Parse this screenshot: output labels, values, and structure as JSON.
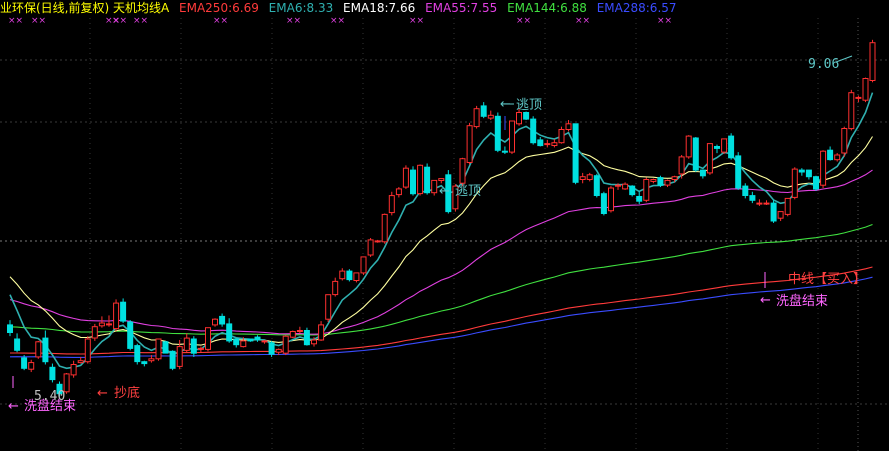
{
  "header": {
    "title": "业环保(日线,前复权) 天机均线A",
    "ema_items": [
      {
        "text": "EMA250:6.69",
        "color": "#ff3b3b"
      },
      {
        "text": "EMA6:8.33",
        "color": "#2fb0b0"
      },
      {
        "text": "EMA18:7.66",
        "color": "#ffffff"
      },
      {
        "text": "EMA55:7.55",
        "color": "#e040e0"
      },
      {
        "text": "EMA144:6.88",
        "color": "#40e040"
      },
      {
        "text": "EMA288:6.57",
        "color": "#3a4cff"
      }
    ]
  },
  "annotations": [
    {
      "key": "flee_top_1",
      "text": "逃顶"
    },
    {
      "key": "flee_top_2",
      "text": "逃顶"
    },
    {
      "key": "bottom_fish",
      "text": "抄底"
    },
    {
      "key": "wash_end_1",
      "text": "洗盘结束"
    },
    {
      "key": "wash_end_2",
      "text": "洗盘结束"
    },
    {
      "key": "midline",
      "text": "中线【买入】"
    }
  ],
  "price_labels": {
    "high": "9.06",
    "low": "5.40"
  },
  "chart_data": {
    "type": "candlestick",
    "ylim": [
      5.1,
      9.55
    ],
    "grid": true,
    "colors": {
      "up": "#ff3030",
      "down": "#00e0e0",
      "ema6": "#2fb0b0",
      "ema18": "#ffffa0",
      "ema55": "#e040e0",
      "ema144": "#40e040",
      "ema250": "#ff3b3b",
      "ema288": "#3a4cff"
    },
    "close": [
      6.24,
      6.05,
      5.86,
      5.92,
      6.14,
      5.93,
      5.74,
      5.59,
      5.8,
      5.9,
      5.94,
      6.17,
      6.3,
      6.34,
      6.33,
      6.55,
      6.36,
      6.07,
      5.93,
      5.91,
      5.96,
      6.17,
      6.02,
      5.86,
      6.09,
      6.18,
      6.02,
      6.07,
      6.29,
      6.38,
      6.33,
      6.15,
      6.11,
      6.15,
      6.15,
      6.16,
      6.15,
      6.01,
      6.06,
      6.2,
      6.25,
      6.26,
      6.11,
      6.16,
      6.32,
      6.64,
      6.78,
      6.89,
      6.8,
      6.87,
      7.04,
      7.22,
      7.21,
      7.49,
      7.69,
      7.76,
      7.98,
      7.71,
      8.01,
      7.72,
      7.85,
      7.87,
      7.52,
      7.79,
      8.08,
      8.43,
      8.61,
      8.53,
      8.54,
      8.17,
      8.15,
      8.48,
      8.57,
      8.5,
      8.25,
      8.22,
      8.24,
      8.25,
      8.39,
      8.45,
      7.83,
      7.89,
      7.91,
      7.69,
      7.5,
      7.77,
      7.8,
      7.81,
      7.7,
      7.63,
      7.86,
      7.86,
      7.8,
      7.85,
      7.89,
      8.1,
      8.32,
      7.96,
      7.9,
      8.24,
      8.19,
      8.29,
      8.09,
      7.77,
      7.69,
      7.64,
      7.61,
      7.61,
      7.42,
      7.52,
      7.66,
      7.97,
      7.94,
      7.89,
      7.76,
      8.16,
      8.07,
      8.12,
      8.4,
      8.78,
      8.73,
      8.93,
      9.31
    ],
    "open": [
      6.32,
      6.17,
      5.97,
      5.85,
      5.98,
      6.18,
      5.87,
      5.69,
      5.61,
      5.79,
      5.92,
      5.93,
      6.18,
      6.31,
      6.33,
      6.28,
      6.56,
      6.35,
      6.1,
      5.93,
      5.94,
      5.96,
      6.14,
      6.04,
      5.88,
      6.05,
      6.17,
      6.06,
      6.06,
      6.32,
      6.41,
      6.33,
      6.17,
      6.09,
      6.17,
      6.19,
      6.14,
      6.13,
      6.03,
      6.02,
      6.19,
      6.25,
      6.26,
      6.12,
      6.16,
      6.38,
      6.64,
      6.81,
      6.89,
      6.79,
      6.87,
      7.06,
      7.21,
      7.2,
      7.51,
      7.7,
      7.78,
      7.96,
      7.71,
      7.99,
      7.72,
      7.85,
      7.91,
      7.55,
      7.82,
      8.04,
      8.42,
      8.64,
      8.51,
      8.53,
      8.16,
      8.15,
      8.45,
      8.57,
      8.5,
      8.28,
      8.23,
      8.22,
      8.25,
      8.39,
      8.45,
      7.86,
      7.86,
      7.9,
      7.71,
      7.53,
      7.79,
      7.76,
      7.79,
      7.68,
      7.64,
      7.84,
      7.88,
      7.8,
      7.86,
      7.92,
      8.1,
      8.3,
      7.96,
      7.93,
      8.21,
      8.15,
      8.32,
      8.11,
      7.79,
      7.69,
      7.61,
      7.61,
      7.61,
      7.45,
      7.49,
      7.67,
      7.96,
      7.96,
      7.89,
      7.8,
      8.17,
      8.07,
      8.14,
      8.4,
      8.73,
      8.7,
      8.91
    ],
    "high": [
      6.37,
      6.23,
      6.0,
      5.95,
      6.15,
      6.26,
      5.91,
      5.72,
      5.81,
      5.94,
      5.98,
      6.2,
      6.33,
      6.41,
      6.42,
      6.59,
      6.6,
      6.37,
      6.12,
      5.94,
      6.0,
      6.17,
      6.15,
      6.05,
      6.16,
      6.23,
      6.2,
      6.09,
      6.29,
      6.39,
      6.44,
      6.39,
      6.17,
      6.19,
      6.17,
      6.21,
      6.16,
      6.15,
      6.07,
      6.21,
      6.26,
      6.3,
      6.29,
      6.19,
      6.36,
      6.64,
      6.82,
      6.92,
      6.91,
      6.87,
      7.04,
      7.24,
      7.22,
      7.5,
      7.73,
      7.78,
      8.01,
      8.0,
      8.02,
      8.03,
      7.85,
      7.87,
      7.96,
      7.81,
      8.09,
      8.46,
      8.64,
      8.68,
      8.59,
      8.57,
      8.21,
      8.48,
      8.61,
      8.58,
      8.53,
      8.31,
      8.28,
      8.29,
      8.42,
      8.49,
      8.45,
      7.93,
      7.93,
      7.92,
      7.73,
      7.79,
      7.82,
      7.83,
      7.8,
      7.73,
      7.88,
      7.87,
      7.9,
      7.86,
      7.9,
      8.12,
      8.33,
      8.31,
      7.96,
      8.24,
      8.23,
      8.29,
      8.35,
      8.15,
      7.82,
      7.73,
      7.65,
      7.64,
      7.64,
      7.52,
      7.66,
      7.99,
      7.98,
      7.96,
      7.9,
      8.17,
      8.21,
      8.14,
      8.42,
      8.81,
      8.75,
      8.94,
      9.34
    ],
    "low": [
      6.2,
      6.03,
      5.84,
      5.82,
      5.96,
      5.9,
      5.71,
      5.56,
      5.59,
      5.76,
      5.91,
      5.91,
      6.15,
      6.29,
      6.3,
      6.25,
      6.34,
      6.05,
      5.9,
      5.88,
      5.92,
      5.94,
      6.02,
      5.84,
      5.85,
      6.03,
      5.98,
      6.03,
      6.04,
      6.3,
      6.3,
      6.13,
      6.08,
      6.08,
      6.14,
      6.14,
      6.12,
      5.98,
      6.0,
      6.0,
      6.18,
      6.23,
      6.1,
      6.09,
      6.15,
      6.35,
      6.62,
      6.79,
      6.78,
      6.77,
      6.85,
      7.04,
      7.19,
      7.18,
      7.48,
      7.67,
      7.76,
      7.69,
      7.69,
      7.7,
      7.69,
      7.82,
      7.5,
      7.52,
      7.79,
      8.02,
      8.4,
      8.51,
      8.49,
      8.15,
      8.13,
      8.13,
      8.43,
      8.49,
      8.23,
      8.21,
      8.2,
      8.2,
      8.24,
      8.37,
      7.81,
      7.82,
      7.84,
      7.67,
      7.48,
      7.51,
      7.75,
      7.75,
      7.68,
      7.6,
      7.62,
      7.82,
      7.78,
      7.78,
      7.83,
      7.87,
      8.08,
      7.94,
      7.87,
      7.91,
      8.14,
      8.13,
      8.07,
      7.75,
      7.66,
      7.61,
      7.58,
      7.59,
      7.4,
      7.42,
      7.47,
      7.65,
      7.9,
      7.86,
      7.74,
      7.77,
      8.06,
      8.05,
      8.1,
      8.38,
      8.68,
      8.68,
      8.89
    ]
  }
}
